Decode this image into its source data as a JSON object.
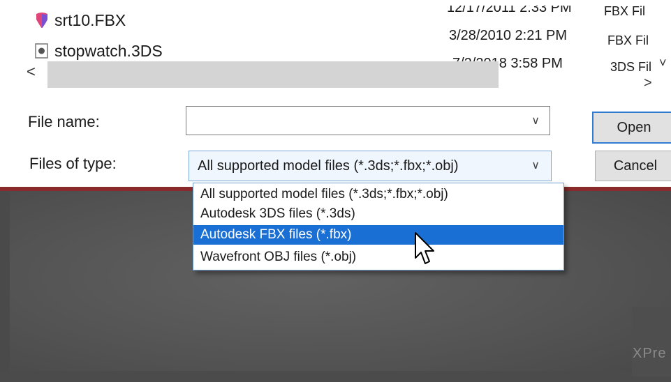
{
  "file_list": {
    "rows": [
      {
        "name": "srt10.FBX",
        "icon": "fbx-file-icon",
        "date": "12/17/2011 2:33 PM",
        "type": "FBX Fil"
      },
      {
        "name": "stopwatch.3DS",
        "icon": "3ds-file-icon",
        "date": "3/28/2010 2:21 PM",
        "type": "FBX Fil"
      },
      {
        "name": "",
        "icon": "",
        "date": "7/2/2018 3:58 PM",
        "type": "3DS Fil"
      }
    ]
  },
  "scroll": {
    "left_arrow": "<",
    "right_arrow": ">",
    "down_arrow": "˅"
  },
  "form": {
    "file_name_label": "File name:",
    "file_name_value": "",
    "files_of_type_label": "Files of type:",
    "files_of_type_value": "All supported model files (*.3ds;*.fbx;*.obj)",
    "dropdown_arrow": "∨"
  },
  "buttons": {
    "open": "Open",
    "cancel": "Cancel"
  },
  "dropdown_options": [
    {
      "label": "All supported model files (*.3ds;*.fbx;*.obj)",
      "selected": false
    },
    {
      "label": "Autodesk 3DS files (*.3ds)",
      "selected": false
    },
    {
      "label": "Autodesk FBX files (*.fbx)",
      "selected": true
    },
    {
      "label": "Wavefront OBJ files (*.obj)",
      "selected": false
    }
  ],
  "watermark": "XPre",
  "colors": {
    "selection": "#1a6fd4",
    "primary_border": "#2f7bd1",
    "fbx_icon": "#e0457a"
  }
}
